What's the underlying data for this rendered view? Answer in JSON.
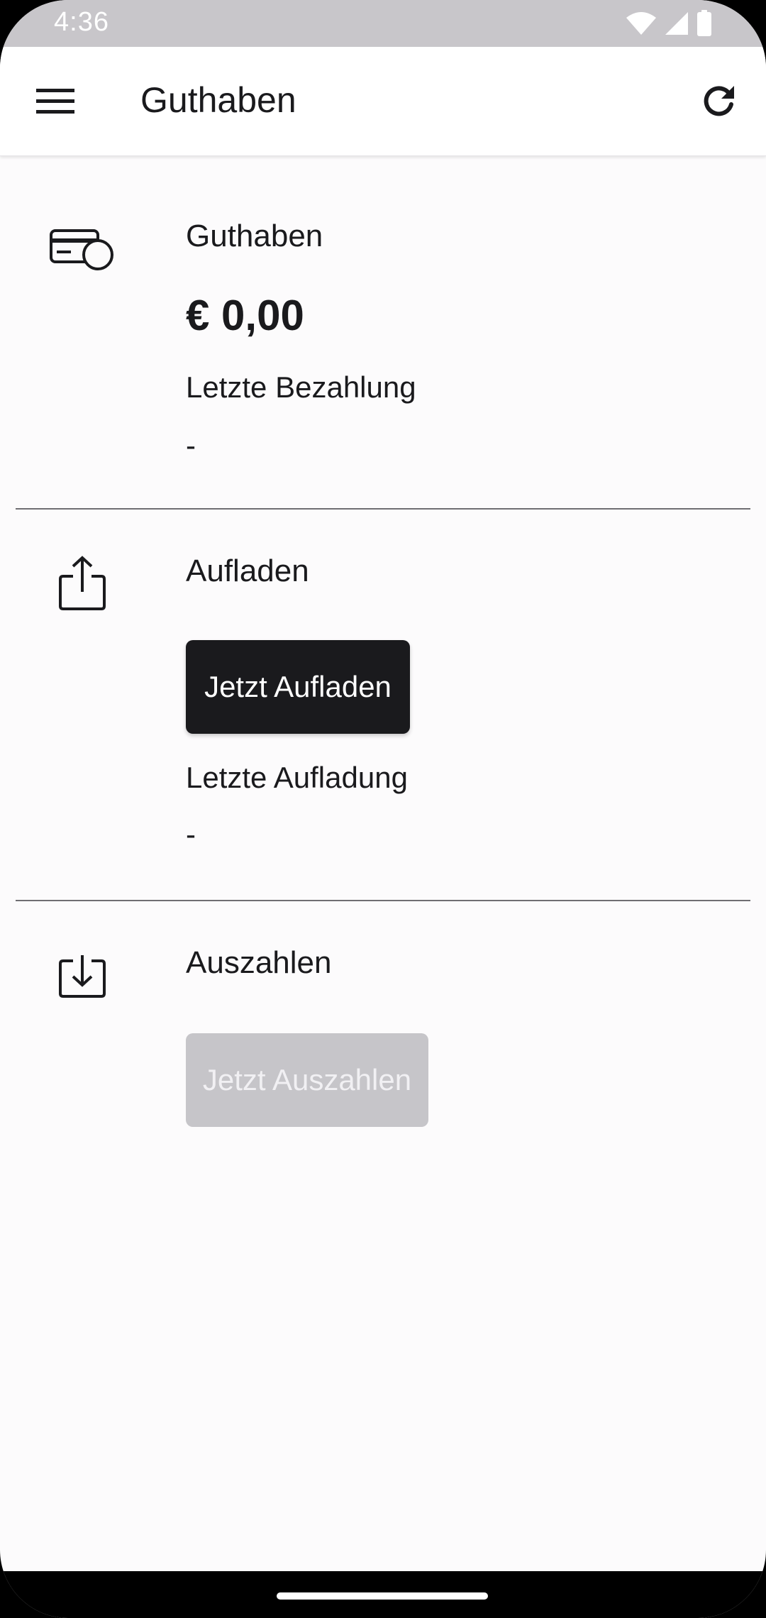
{
  "status_bar": {
    "time": "4:36",
    "icons": [
      "wifi-icon",
      "signal-icon",
      "battery-icon"
    ]
  },
  "app_bar": {
    "title": "Guthaben",
    "menu_icon": "menu-icon",
    "refresh_icon": "refresh-icon"
  },
  "balance": {
    "heading": "Guthaben",
    "amount": "€ 0,00",
    "last_payment_label": "Letzte Bezahlung",
    "last_payment_value": "-",
    "icon": "card-coin-icon"
  },
  "top_up": {
    "heading": "Aufladen",
    "button_label": "Jetzt Aufladen",
    "last_top_up_label": "Letzte Aufladung",
    "last_top_up_value": "-",
    "icon": "upload-icon"
  },
  "payout": {
    "heading": "Auszahlen",
    "button_label": "Jetzt Auszahlen",
    "button_disabled": true,
    "icon": "download-icon"
  },
  "colors": {
    "background": "#fcfbfc",
    "text": "#1a1a1d",
    "primary_button": "#1a1a1d",
    "disabled_button": "#c6c5c9",
    "status_bar": "#c8c6ca"
  }
}
